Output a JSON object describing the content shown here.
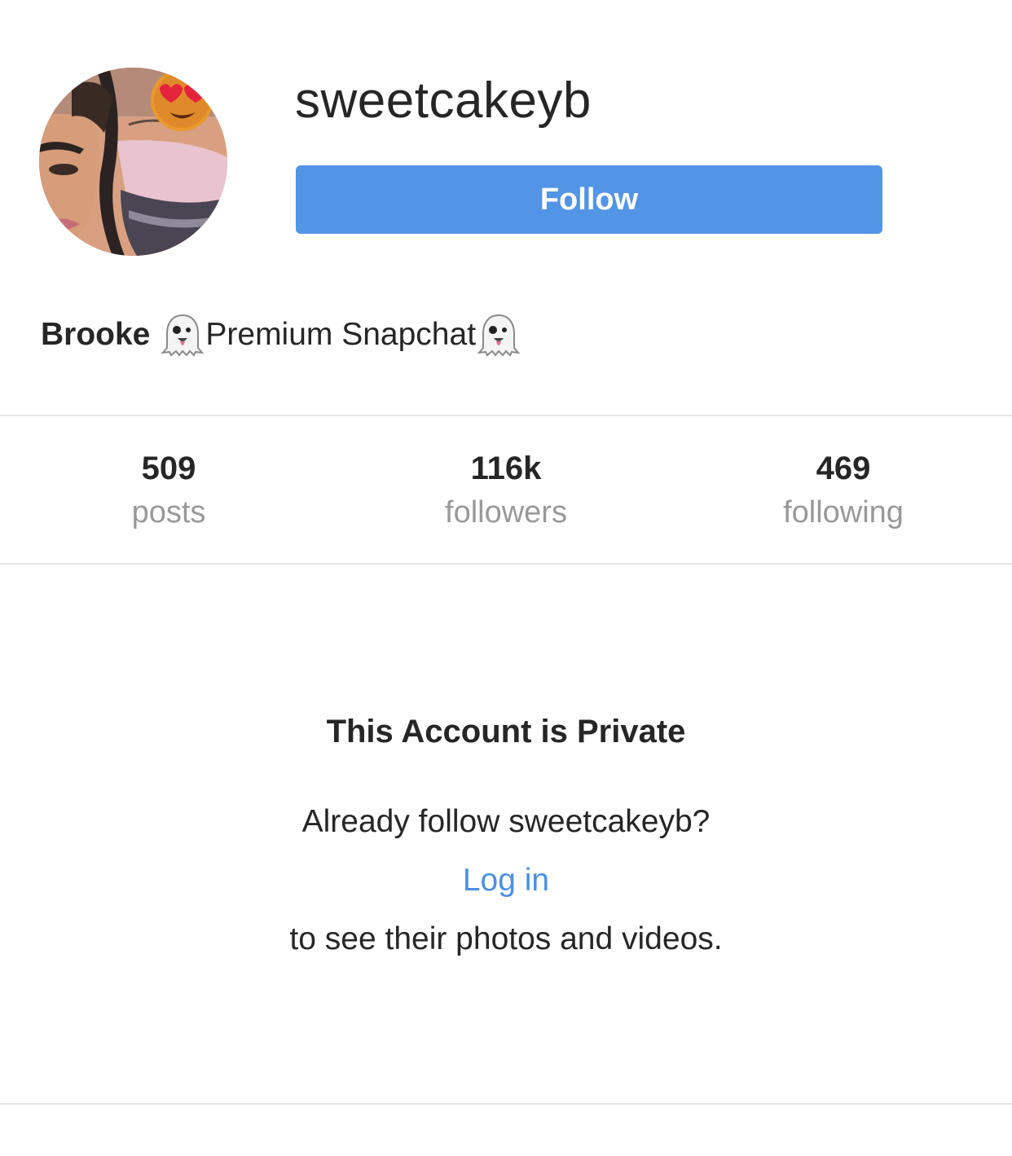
{
  "profile": {
    "username": "sweetcakeyb",
    "follow_label": "Follow",
    "bio_name": "Brooke",
    "bio_text": "Premium Snapchat",
    "bio_icon": "ghost-emoji-icon",
    "avatar_icon": "profile-photo"
  },
  "stats": {
    "posts": {
      "value": "509",
      "label": "posts"
    },
    "followers": {
      "value": "116k",
      "label": "followers"
    },
    "following": {
      "value": "469",
      "label": "following"
    }
  },
  "private": {
    "title": "This Account is Private",
    "already_follow": "Already follow sweetcakeyb?",
    "login_label": "Log in",
    "see_text": "to see their photos and videos."
  },
  "colors": {
    "accent": "#5294e6",
    "link": "#4a90e2",
    "text": "#262626",
    "muted": "#999999",
    "divider": "#e6e6e6"
  }
}
